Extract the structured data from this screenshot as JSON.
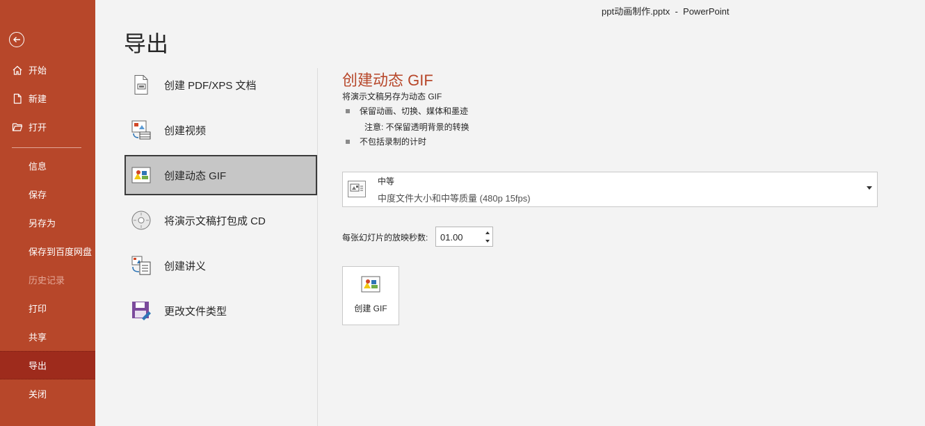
{
  "window": {
    "title": "ppt动画制作.pptx  -  PowerPoint"
  },
  "sidebar": {
    "top_items": [
      {
        "label": "开始",
        "icon": "home-icon"
      },
      {
        "label": "新建",
        "icon": "new-document-icon"
      },
      {
        "label": "打开",
        "icon": "open-folder-icon"
      }
    ],
    "bottom_items": [
      {
        "label": "信息"
      },
      {
        "label": "保存"
      },
      {
        "label": "另存为"
      },
      {
        "label": "保存到百度网盘"
      },
      {
        "label": "历史记录",
        "disabled": true
      },
      {
        "label": "打印"
      },
      {
        "label": "共享"
      },
      {
        "label": "导出",
        "active": true
      },
      {
        "label": "关闭"
      }
    ]
  },
  "page": {
    "title": "导出"
  },
  "options": [
    {
      "label": "创建 PDF/XPS 文档",
      "icon": "pdf-document-icon"
    },
    {
      "label": "创建视频",
      "icon": "video-icon"
    },
    {
      "label": "创建动态 GIF",
      "icon": "gif-icon",
      "selected": true
    },
    {
      "label": "将演示文稿打包成 CD",
      "icon": "cd-icon"
    },
    {
      "label": "创建讲义",
      "icon": "handout-icon"
    },
    {
      "label": "更改文件类型",
      "icon": "change-file-type-icon"
    }
  ],
  "detail": {
    "title": "创建动态 GIF",
    "description": "将演示文稿另存为动态 GIF",
    "bullet1": "保留动画、切换、媒体和墨迹",
    "note": "注意: 不保留透明背景的转换",
    "bullet2": "不包括录制的计时",
    "quality": {
      "selected_label": "中等",
      "selected_desc": "中度文件大小和中等质量 (480p 15fps)"
    },
    "seconds_label": "每张幻灯片的放映秒数:",
    "seconds_value": "01.00",
    "create_button": "创建 GIF"
  },
  "colors": {
    "accent": "#b7472a",
    "active_nav": "#9e2b1c",
    "background": "#f3f3f3"
  }
}
